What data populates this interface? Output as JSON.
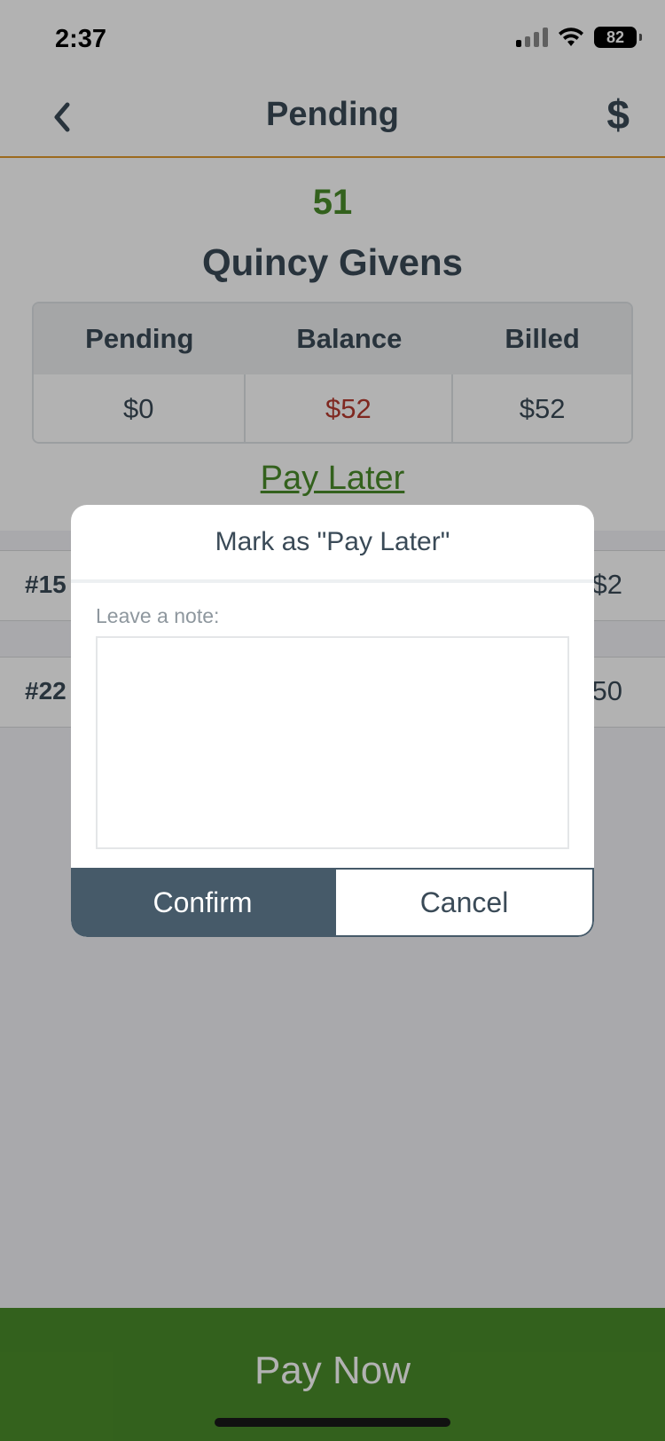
{
  "status_bar": {
    "time": "2:37",
    "battery": "82"
  },
  "nav": {
    "title": "Pending",
    "back_icon": "chevron-left-icon",
    "action_icon": "$"
  },
  "member": {
    "id": "51",
    "name": "Quincy Givens"
  },
  "summary": {
    "headers": [
      "Pending",
      "Balance",
      "Billed"
    ],
    "values": [
      "$0",
      "$52",
      "$52"
    ],
    "balance_color": "#b63a2e"
  },
  "pay_later_link": "Pay Later",
  "rows": [
    {
      "id": "#15",
      "amount": "$2"
    },
    {
      "id": "#22",
      "amount": "50"
    }
  ],
  "pay_now_label": "Pay Now",
  "modal": {
    "title": "Mark as \"Pay Later\"",
    "note_label": "Leave a note:",
    "note_value": "",
    "confirm_label": "Confirm",
    "cancel_label": "Cancel"
  },
  "colors": {
    "accent_green": "#4a8c2a",
    "header_divider": "#e0982c",
    "confirm_bg": "#465a69",
    "text_dark": "#3a4a57"
  }
}
